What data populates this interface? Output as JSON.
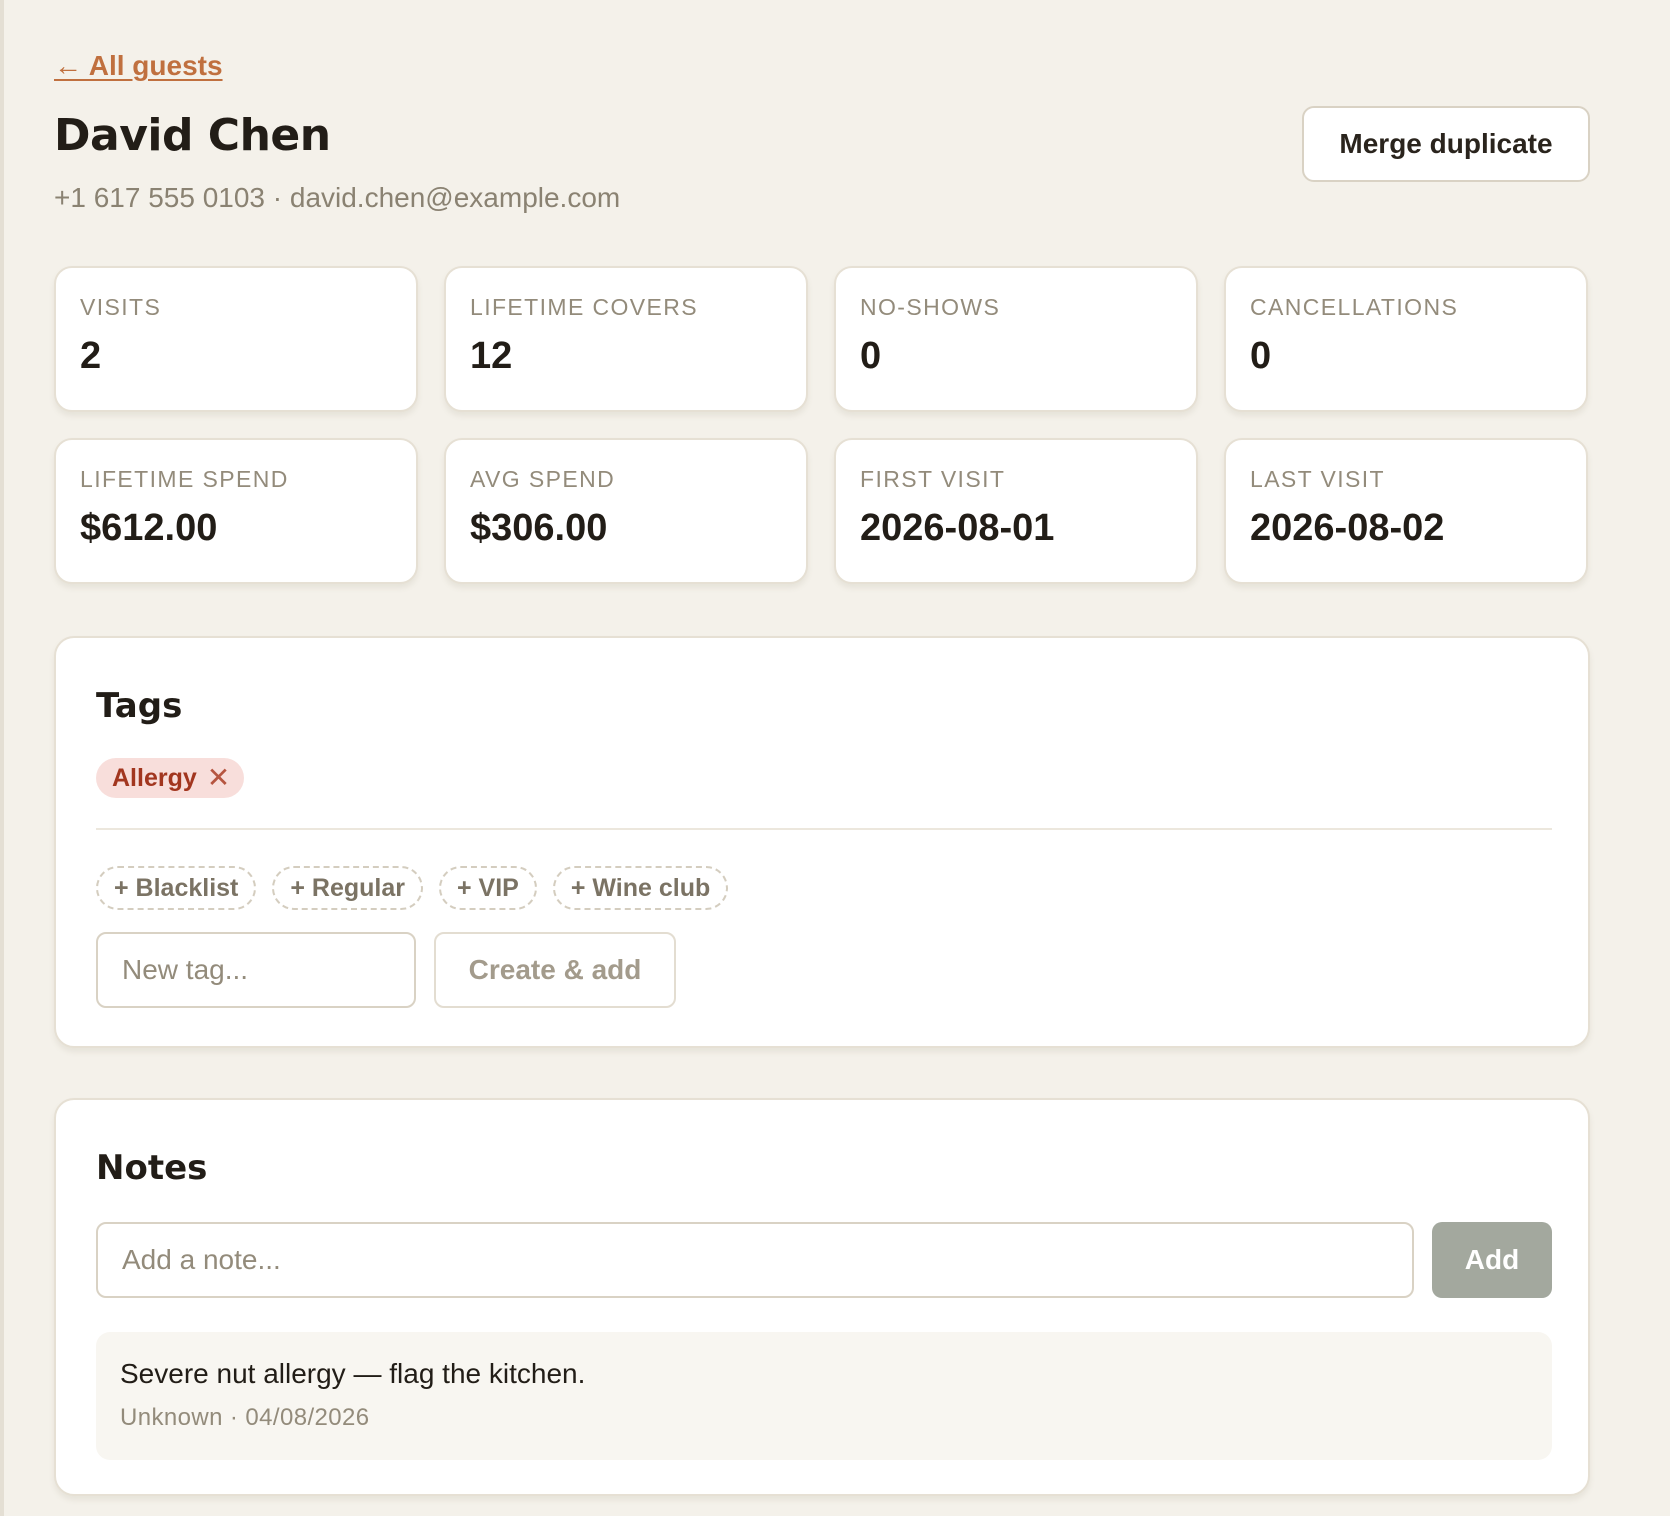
{
  "header": {
    "back_link": "← All guests",
    "guest_name": "David Chen",
    "guest_contact": "+1 617 555 0103 · david.chen@example.com",
    "merge_button": "Merge duplicate"
  },
  "stats": [
    {
      "label": "VISITS",
      "value": "2"
    },
    {
      "label": "LIFETIME COVERS",
      "value": "12"
    },
    {
      "label": "NO-SHOWS",
      "value": "0"
    },
    {
      "label": "CANCELLATIONS",
      "value": "0"
    },
    {
      "label": "LIFETIME SPEND",
      "value": "$612.00"
    },
    {
      "label": "AVG SPEND",
      "value": "$306.00"
    },
    {
      "label": "FIRST VISIT",
      "value": "2026-08-01"
    },
    {
      "label": "LAST VISIT",
      "value": "2026-08-02"
    }
  ],
  "tags": {
    "title": "Tags",
    "applied": [
      {
        "label": "Allergy",
        "remove_glyph": "✕"
      }
    ],
    "suggestions": [
      {
        "label": "+ Blacklist"
      },
      {
        "label": "+ Regular"
      },
      {
        "label": "+ VIP"
      },
      {
        "label": "+ Wine club"
      }
    ],
    "new_tag_placeholder": "New tag...",
    "create_button": "Create & add"
  },
  "notes": {
    "title": "Notes",
    "input_placeholder": "Add a note...",
    "add_button": "Add",
    "items": [
      {
        "text": "Severe nut allergy — flag the kitchen.",
        "meta": "Unknown · 04/08/2026"
      }
    ]
  },
  "colors": {
    "background": "#f4f1ea",
    "accent_link": "#c0703f",
    "allergy_tag_bg": "#f8dedb",
    "allergy_tag_text": "#a2361f",
    "add_button_bg": "#a3a89e"
  }
}
